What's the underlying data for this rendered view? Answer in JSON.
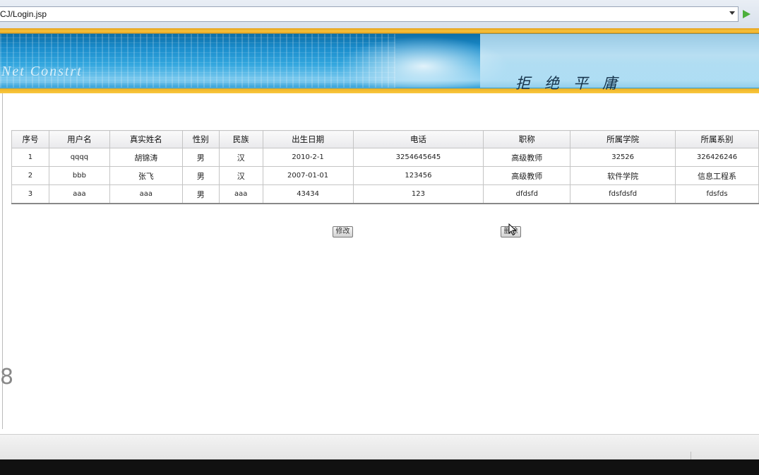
{
  "browser": {
    "address": "CJ/Login.jsp"
  },
  "banner": {
    "brand": "Net Constrt",
    "slogan": "拒绝平庸 "
  },
  "table": {
    "headers": [
      "序号",
      "用户名",
      "真实姓名",
      "性别",
      "民族",
      "出生日期",
      "电话",
      "职称",
      "所属学院",
      "所属系别"
    ],
    "rows": [
      [
        "1",
        "qqqq",
        "胡锦涛",
        "男",
        "汉",
        "2010-2-1",
        "3254645645",
        "高级教师",
        "32526",
        "326426246"
      ],
      [
        "2",
        "bbb",
        "张飞",
        "男",
        "汉",
        "2007-01-01",
        "123456",
        "高级教师",
        "软件学院",
        "信息工程系"
      ],
      [
        "3",
        "aaa",
        "aaa",
        "男",
        "aaa",
        "43434",
        "123",
        "dfdsfd",
        "fdsfdsfd",
        "fdsfds"
      ]
    ]
  },
  "actions": {
    "edit_label": "修改",
    "delete_label": "删除"
  },
  "icons": {
    "go": "play-arrow-icon",
    "dropdown": "chevron-down-icon",
    "cursor": "mouse-pointer-icon"
  }
}
